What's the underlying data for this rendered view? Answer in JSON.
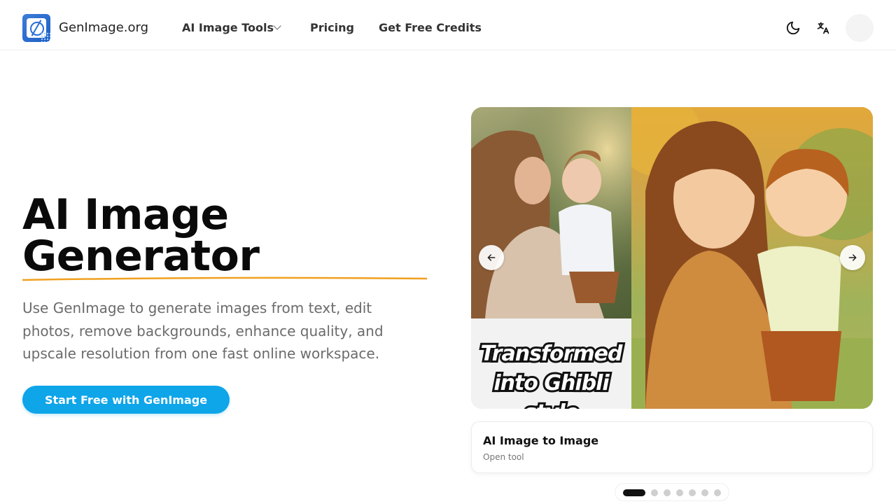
{
  "header": {
    "brand": "GenImage.org",
    "nav": {
      "tools_label": "AI Image Tools",
      "pricing_label": "Pricing",
      "credits_label": "Get Free Credits"
    }
  },
  "hero": {
    "title_line1": "AI Image",
    "title_line2": "Generator",
    "description": "Use GenImage to generate images from text, edit photos, remove backgrounds, enhance quality, and upscale resolution from one fast online workspace.",
    "cta_label": "Start Free with GenImage",
    "accent_color": "#0ea5e9",
    "underline_color": "#f0a020"
  },
  "carousel": {
    "overlay_text_line1": "Transformed",
    "overlay_text_line2": "into Ghibli",
    "overlay_text_line3": "style",
    "prev_icon": "arrow-left-icon",
    "next_icon": "arrow-right-icon",
    "card_title": "AI Image to Image",
    "card_subtitle": "Open tool",
    "slide_count": 7,
    "active_slide": 1
  }
}
